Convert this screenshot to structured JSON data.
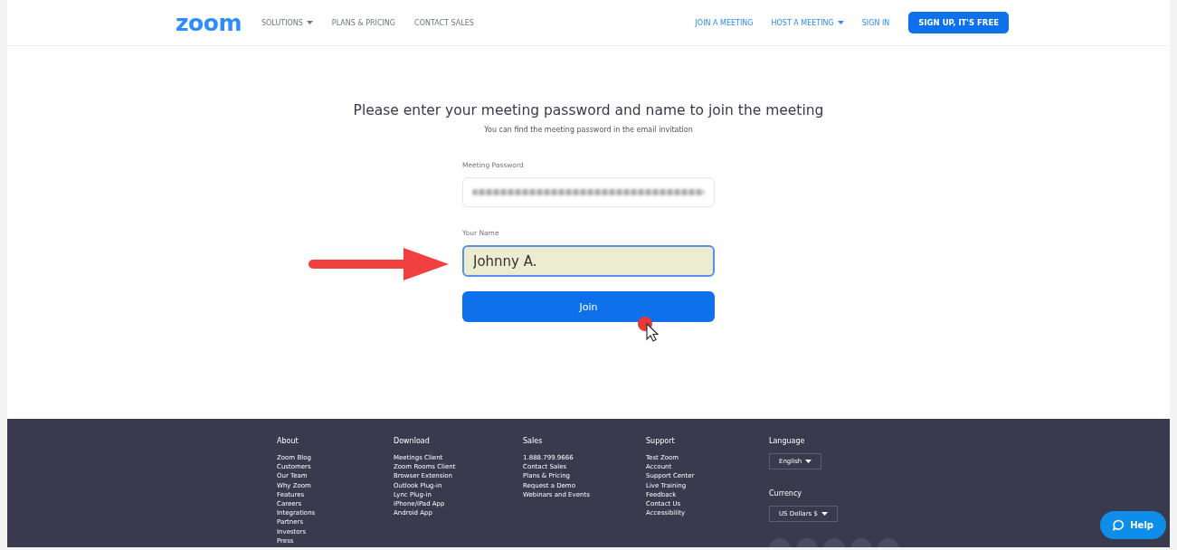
{
  "header": {
    "logo": "zoom",
    "nav_left": [
      {
        "label": "SOLUTIONS",
        "dropdown": true
      },
      {
        "label": "PLANS & PRICING",
        "dropdown": false
      },
      {
        "label": "CONTACT SALES",
        "dropdown": false
      }
    ],
    "nav_right": [
      {
        "label": "JOIN A MEETING",
        "dropdown": false
      },
      {
        "label": "HOST A MEETING",
        "dropdown": true
      },
      {
        "label": "SIGN IN",
        "dropdown": false
      }
    ],
    "signup_button": "SIGN UP, IT'S FREE"
  },
  "form": {
    "title": "Please enter your meeting password and name to join the meeting",
    "subtitle": "You can find the meeting password in the email invitation",
    "password_label": "Meeting Password",
    "name_label": "Your Name",
    "name_value": "Johnny A.",
    "join_button": "Join"
  },
  "footer": {
    "columns": [
      {
        "heading": "About",
        "links": [
          "Zoom Blog",
          "Customers",
          "Our Team",
          "Why Zoom",
          "Features",
          "Careers",
          "Integrations",
          "Partners",
          "Investors",
          "Press"
        ]
      },
      {
        "heading": "Download",
        "links": [
          "Meetings Client",
          "Zoom Rooms Client",
          "Browser Extension",
          "Outlook Plug-in",
          "Lync Plug-in",
          "iPhone/iPad App",
          "Android App"
        ]
      },
      {
        "heading": "Sales",
        "links": [
          "1.888.799.9666",
          "Contact Sales",
          "Plans & Pricing",
          "Request a Demo",
          "Webinars and Events"
        ]
      },
      {
        "heading": "Support",
        "links": [
          "Test Zoom",
          "Account",
          "Support Center",
          "Live Training",
          "Feedback",
          "Contact Us",
          "Accessibility"
        ]
      }
    ],
    "language_label": "Language",
    "language_value": "English",
    "currency_label": "Currency",
    "currency_value": "US Dollars $"
  },
  "help_button": "Help"
}
